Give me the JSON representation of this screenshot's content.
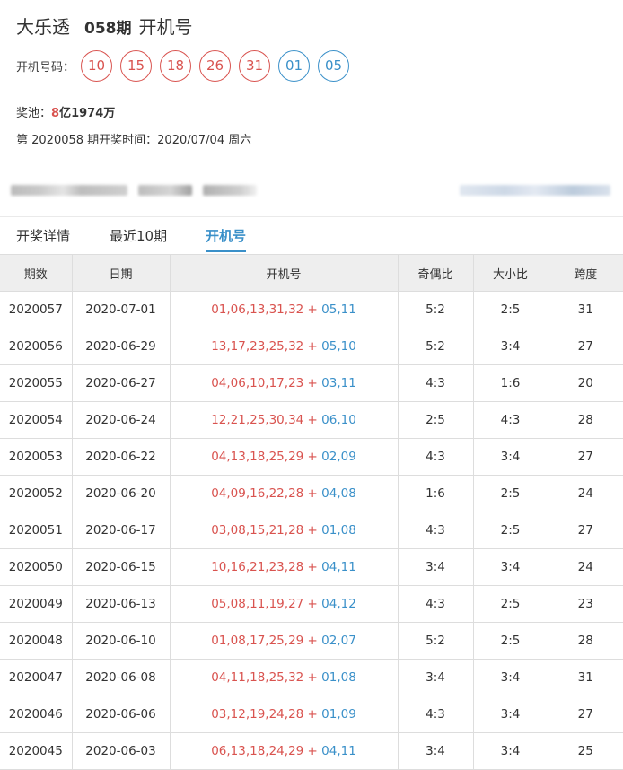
{
  "header": {
    "lottery_name": "大乐透",
    "issue": "058期",
    "label": "开机号"
  },
  "draw": {
    "label": "开机号码：",
    "red": [
      "10",
      "15",
      "18",
      "26",
      "31"
    ],
    "blue": [
      "01",
      "05"
    ]
  },
  "pool": {
    "label": "奖池：",
    "amount_a": "8",
    "amount_b": "亿1974万"
  },
  "draw_time": "第 2020058 期开奖时间：2020/07/04 周六",
  "tabs": [
    {
      "label": "开奖详情",
      "active": false
    },
    {
      "label": "最近10期",
      "active": false
    },
    {
      "label": "开机号",
      "active": true
    }
  ],
  "table": {
    "headers": [
      "期数",
      "日期",
      "开机号",
      "奇偶比",
      "大小比",
      "跨度"
    ],
    "rows": [
      {
        "issue": "2020057",
        "date": "2020-07-01",
        "red": "01,06,13,31,32",
        "blue": "05,11",
        "odd_even": "5:2",
        "big_small": "2:5",
        "span": "31"
      },
      {
        "issue": "2020056",
        "date": "2020-06-29",
        "red": "13,17,23,25,32",
        "blue": "05,10",
        "odd_even": "5:2",
        "big_small": "3:4",
        "span": "27"
      },
      {
        "issue": "2020055",
        "date": "2020-06-27",
        "red": "04,06,10,17,23",
        "blue": "03,11",
        "odd_even": "4:3",
        "big_small": "1:6",
        "span": "20"
      },
      {
        "issue": "2020054",
        "date": "2020-06-24",
        "red": "12,21,25,30,34",
        "blue": "06,10",
        "odd_even": "2:5",
        "big_small": "4:3",
        "span": "28"
      },
      {
        "issue": "2020053",
        "date": "2020-06-22",
        "red": "04,13,18,25,29",
        "blue": "02,09",
        "odd_even": "4:3",
        "big_small": "3:4",
        "span": "27"
      },
      {
        "issue": "2020052",
        "date": "2020-06-20",
        "red": "04,09,16,22,28",
        "blue": "04,08",
        "odd_even": "1:6",
        "big_small": "2:5",
        "span": "24"
      },
      {
        "issue": "2020051",
        "date": "2020-06-17",
        "red": "03,08,15,21,28",
        "blue": "01,08",
        "odd_even": "4:3",
        "big_small": "2:5",
        "span": "27"
      },
      {
        "issue": "2020050",
        "date": "2020-06-15",
        "red": "10,16,21,23,28",
        "blue": "04,11",
        "odd_even": "3:4",
        "big_small": "3:4",
        "span": "24"
      },
      {
        "issue": "2020049",
        "date": "2020-06-13",
        "red": "05,08,11,19,27",
        "blue": "04,12",
        "odd_even": "4:3",
        "big_small": "2:5",
        "span": "23"
      },
      {
        "issue": "2020048",
        "date": "2020-06-10",
        "red": "01,08,17,25,29",
        "blue": "02,07",
        "odd_even": "5:2",
        "big_small": "2:5",
        "span": "28"
      },
      {
        "issue": "2020047",
        "date": "2020-06-08",
        "red": "04,11,18,25,32",
        "blue": "01,08",
        "odd_even": "3:4",
        "big_small": "3:4",
        "span": "31"
      },
      {
        "issue": "2020046",
        "date": "2020-06-06",
        "red": "03,12,19,24,28",
        "blue": "01,09",
        "odd_even": "4:3",
        "big_small": "3:4",
        "span": "27"
      },
      {
        "issue": "2020045",
        "date": "2020-06-03",
        "red": "06,13,18,24,29",
        "blue": "04,11",
        "odd_even": "3:4",
        "big_small": "3:4",
        "span": "25"
      }
    ]
  },
  "colors": {
    "red": "#d9534f",
    "blue": "#3a90c9",
    "header_bg": "#eeeeee",
    "border": "#dddddd"
  }
}
